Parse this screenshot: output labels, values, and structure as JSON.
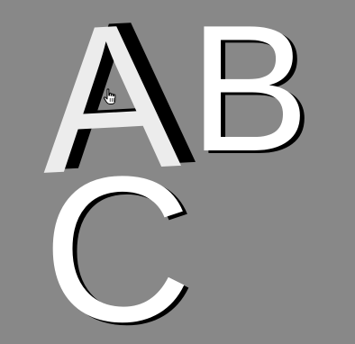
{
  "letters": {
    "a": "A",
    "b": "B",
    "c": "C"
  },
  "colors": {
    "background": "#888888",
    "letter_face": "#ffffff",
    "letter_a_face": "#ececec",
    "shadow": "#000000"
  },
  "cursor": {
    "icon": "hand-pointer-icon"
  }
}
